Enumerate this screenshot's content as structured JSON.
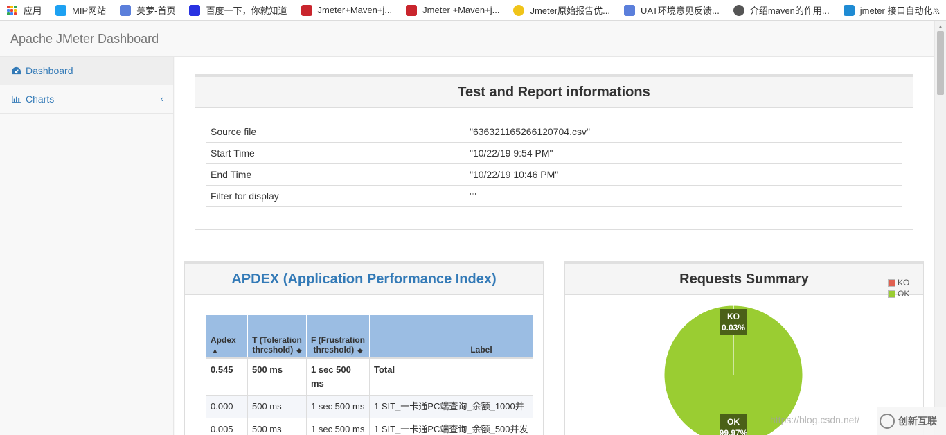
{
  "bookmarks": [
    {
      "label": "应用",
      "icon": "apps-grid-icon",
      "color": "#d93025"
    },
    {
      "label": "MIP网站",
      "icon": "mip-site-icon",
      "color": "#1da1f2"
    },
    {
      "label": "美萝-首页",
      "icon": "cloud-app-icon",
      "color": "#5b7fdb"
    },
    {
      "label": "百度一下，你就知道",
      "icon": "baidu-paw-icon",
      "color": "#2932e1"
    },
    {
      "label": "Jmeter+Maven+j...",
      "icon": "csdn-c-icon",
      "color": "#c9252d"
    },
    {
      "label": "Jmeter +Maven+j...",
      "icon": "csdn-c-icon",
      "color": "#c9252d"
    },
    {
      "label": "Jmeter原始报告优...",
      "icon": "yellow-coin-icon",
      "color": "#f0c419"
    },
    {
      "label": "UAT环境意见反馈...",
      "icon": "cloud-app-icon",
      "color": "#5b7fdb"
    },
    {
      "label": "介绍maven的作用...",
      "icon": "globe-icon",
      "color": "#555555"
    },
    {
      "label": "jmeter 接口自动化...",
      "icon": "blue-square-icon",
      "color": "#1f8bd3"
    }
  ],
  "bookmarks_more": "»",
  "brand": "Apache JMeter Dashboard",
  "sidebar": {
    "items": [
      {
        "label": "Dashboard",
        "icon": "dashboard-gauge-icon",
        "active": true
      },
      {
        "label": "Charts",
        "icon": "bar-chart-icon",
        "chevron": "‹"
      }
    ]
  },
  "info_panel": {
    "title": "Test and Report informations",
    "rows": [
      {
        "key": "Source file",
        "value": "\"636321165266120704.csv\""
      },
      {
        "key": "Start Time",
        "value": "\"10/22/19 9:54 PM\""
      },
      {
        "key": "End Time",
        "value": "\"10/22/19 10:46 PM\""
      },
      {
        "key": "Filter for display",
        "value": "\"\""
      }
    ]
  },
  "apdex_panel": {
    "title": "APDEX (Application Performance Index)",
    "headers": {
      "apdex": "Apdex",
      "t": "T (Toleration threshold)",
      "f": "F (Frustration threshold)",
      "label": "Label"
    },
    "rows": [
      {
        "apdex": "0.545",
        "t": "500 ms",
        "f": "1 sec 500 ms",
        "label": "Total"
      },
      {
        "apdex": "0.000",
        "t": "500 ms",
        "f": "1 sec 500 ms",
        "label": "1 SIT_一卡通PC端查询_余额_1000并"
      },
      {
        "apdex": "0.005",
        "t": "500 ms",
        "f": "1 sec 500 ms",
        "label": "1 SIT_一卡通PC端查询_余额_500并发"
      }
    ]
  },
  "requests_panel": {
    "title": "Requests Summary",
    "chart_data": {
      "type": "pie",
      "legend_position": "top-right",
      "slices": [
        {
          "name": "KO",
          "value": 0.03,
          "label": "0.03%",
          "color": "#e06050"
        },
        {
          "name": "OK",
          "value": 99.97,
          "label": "99.97%",
          "color": "#9acd32"
        }
      ]
    }
  },
  "colors": {
    "link": "#337ab7",
    "apdex_header": "#9bbde3",
    "ok_green": "#9acd32",
    "ko_red": "#e06050",
    "label_box": "#4b6118"
  },
  "watermark": {
    "url": "https://blog.csdn.net/",
    "logo_text": "创新互联"
  }
}
